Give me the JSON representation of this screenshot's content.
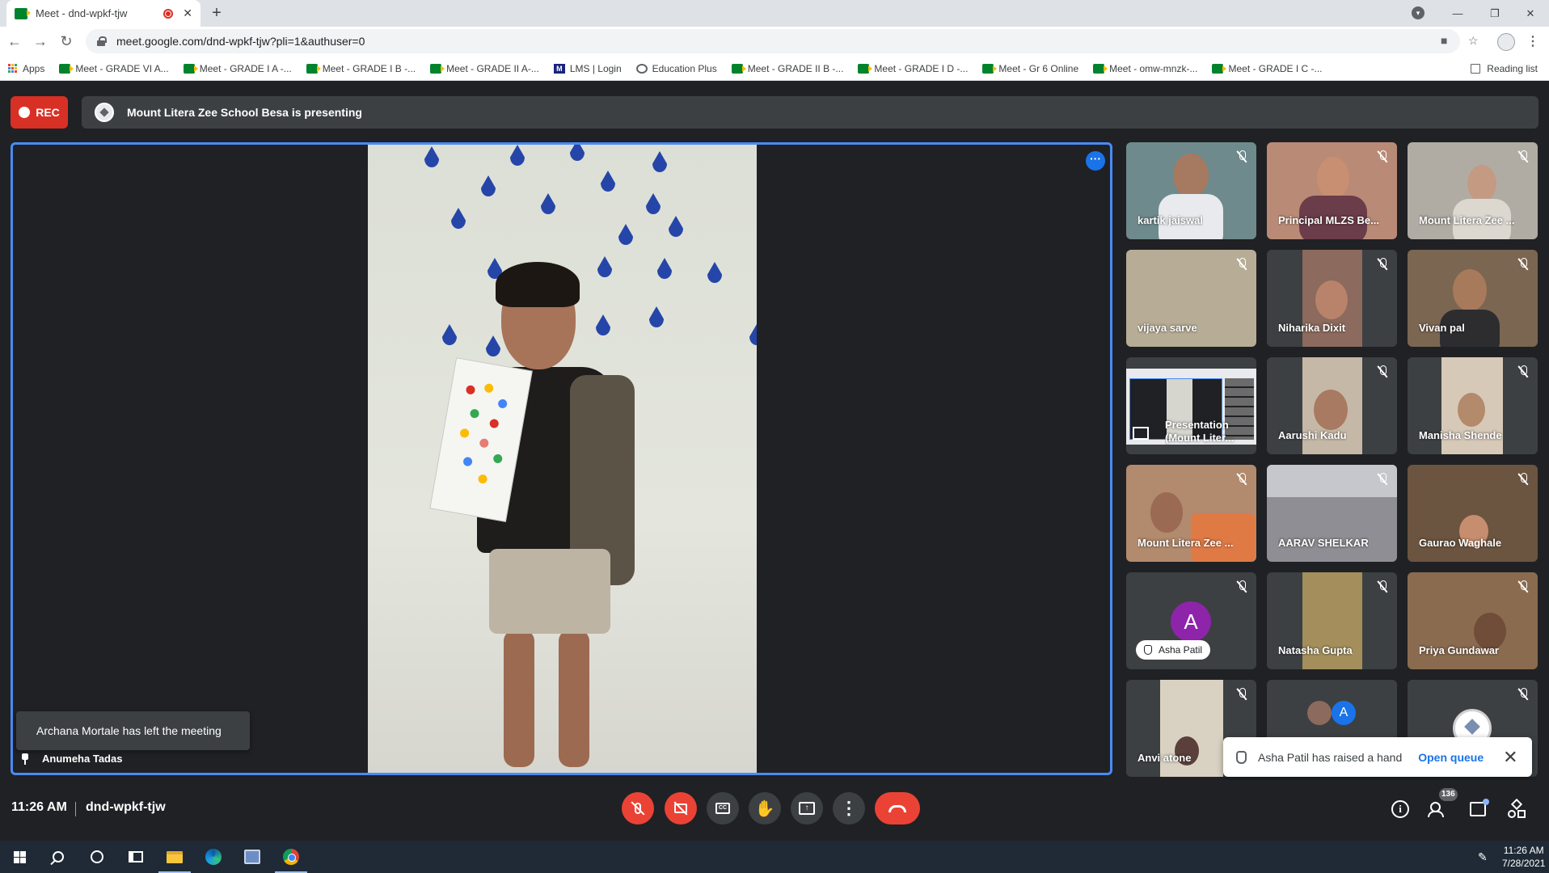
{
  "browser": {
    "tab_title": "Meet - dnd-wpkf-tjw",
    "tab_close": "✕",
    "new_tab": "+",
    "url": "meet.google.com/dnd-wpkf-tjw?pli=1&authuser=0",
    "window_controls": [
      "—",
      "❐",
      "✕"
    ],
    "bookmarks": [
      {
        "label": "Apps",
        "icon": "apps-grid-icon"
      },
      {
        "label": "Meet - GRADE VI A...",
        "icon": "meet-icon"
      },
      {
        "label": "Meet - GRADE I A -...",
        "icon": "meet-icon"
      },
      {
        "label": "Meet - GRADE I B -...",
        "icon": "meet-icon"
      },
      {
        "label": "Meet - GRADE II A-...",
        "icon": "meet-icon"
      },
      {
        "label": "LMS | Login",
        "icon": "lms-icon"
      },
      {
        "label": "Education Plus",
        "icon": "globe-icon"
      },
      {
        "label": "Meet - GRADE II B -...",
        "icon": "meet-icon"
      },
      {
        "label": "Meet - GRADE I D -...",
        "icon": "meet-icon"
      },
      {
        "label": "Meet - Gr 6 Online",
        "icon": "meet-icon"
      },
      {
        "label": "Meet - omw-mnzk-...",
        "icon": "meet-icon"
      },
      {
        "label": "Meet - GRADE I C -...",
        "icon": "meet-icon"
      }
    ],
    "reading_list": "Reading list"
  },
  "meet": {
    "rec_label": "REC",
    "presenting_text": "Mount Litera Zee School Besa is presenting",
    "pinned_name": "Anumeha Tadas",
    "left_toast": "Archana Mortale has left the meeting",
    "hand_toast": {
      "message": "Asha Patil has raised a hand",
      "action": "Open queue",
      "close": "✕"
    },
    "participants": [
      {
        "name": "kartik jaiswal",
        "bg": "#6e8a8c"
      },
      {
        "name": "Principal MLZS Be...",
        "bg": "#b98a76"
      },
      {
        "name": "Mount Litera Zee ...",
        "bg": "#b0aca4"
      },
      {
        "name": "vijaya sarve",
        "bg": "#b7ad96"
      },
      {
        "name": "Niharika Dixit",
        "bg": "#8c6a5d"
      },
      {
        "name": "Vivan pal",
        "bg": "#7b6652"
      },
      {
        "name": "Presentation (Mount Liter...",
        "bg": "#e8eaed"
      },
      {
        "name": "Aarushi Kadu",
        "bg": "#c6b8a6"
      },
      {
        "name": "Manisha Shende",
        "bg": "#d7c9b8"
      },
      {
        "name": "Mount Litera Zee ...",
        "bg": "#b28a6d"
      },
      {
        "name": "AARAV SHELKAR",
        "bg": "#8f8e94"
      },
      {
        "name": "Gaurao Waghale",
        "bg": "#6b5440"
      },
      {
        "name": "Asha Patil",
        "bg": "#3c4043"
      },
      {
        "name": "Natasha Gupta",
        "bg": "#a48f5c"
      },
      {
        "name": "Priya Gundawar",
        "bg": "#8a6b50"
      },
      {
        "name": "Anvi atone",
        "bg": "#d9d2c3"
      },
      {
        "name": "",
        "bg": "#3c4043"
      },
      {
        "name": "",
        "bg": "#3c4043"
      }
    ],
    "avatar_letter": "A",
    "small_avatar_letter": "A"
  },
  "bottom": {
    "time": "11:26 AM",
    "meeting_code": "dnd-wpkf-tjw",
    "participant_count": "136",
    "cc_label": "CC"
  },
  "taskbar": {
    "time": "11:26 AM",
    "date": "7/28/2021"
  },
  "colors": {
    "accent_blue": "#1a73e8",
    "stage_border": "#4a8af4",
    "end_call_red": "#ea4335",
    "rec_red": "#d93025"
  }
}
